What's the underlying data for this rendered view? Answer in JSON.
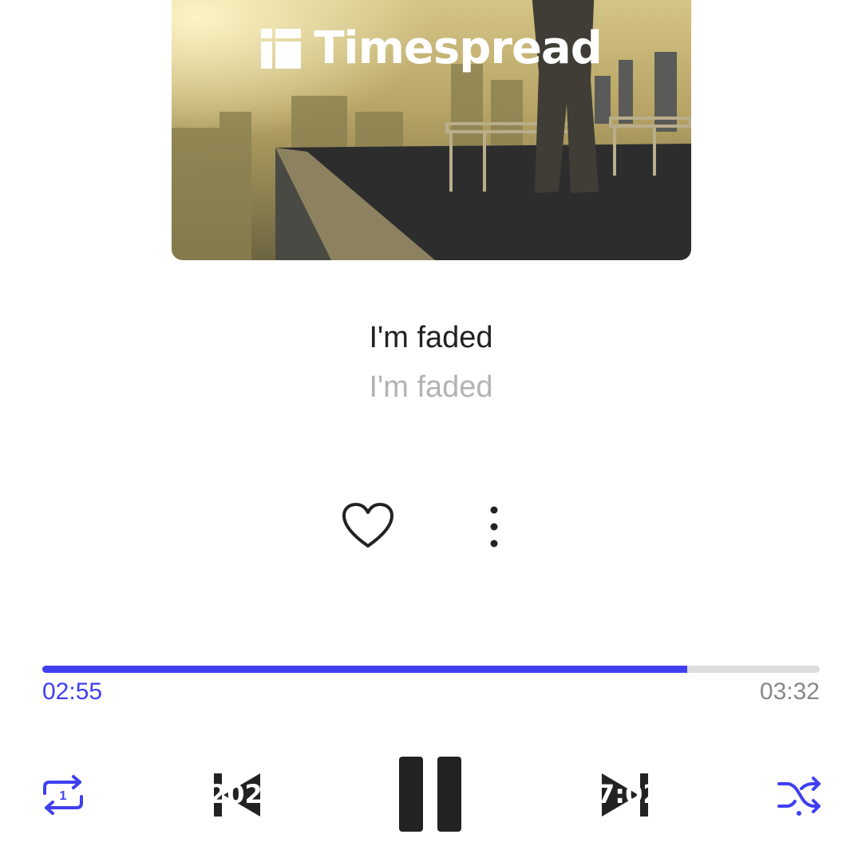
{
  "brand": {
    "name": "Timespread"
  },
  "track": {
    "title": "I'm faded",
    "subtitle": "I'm faded"
  },
  "actions": {
    "like_icon": "heart-icon",
    "more_icon": "more-vertical-icon"
  },
  "playback": {
    "current_time": "02:55",
    "total_time": "03:32",
    "progress_fraction": 0.83,
    "state": "playing"
  },
  "controls": {
    "repeat_icon": "repeat-one-icon",
    "prev_icon": "skip-previous-icon",
    "pause_icon": "pause-icon",
    "next_icon": "skip-next-icon",
    "shuffle_icon": "shuffle-icon",
    "prev_overlay_text": "202",
    "next_overlay_text": "7:02"
  },
  "colors": {
    "accent": "#3f3ff0",
    "track": "#dddddd",
    "text": "#222222",
    "muted": "#b3b3b3"
  }
}
